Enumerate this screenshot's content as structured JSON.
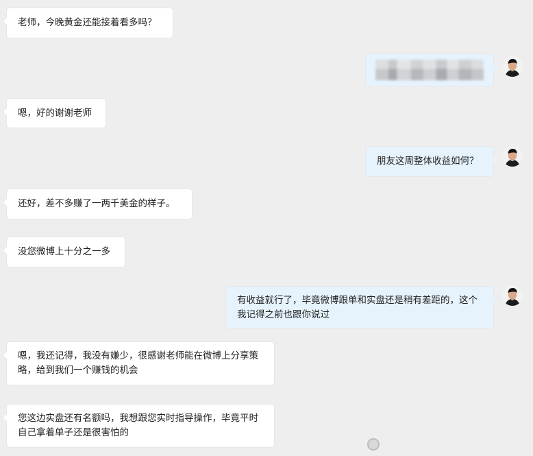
{
  "conversation": {
    "messages": [
      {
        "side": "left",
        "text": "老师，今晚黄金还能接着看多吗？"
      },
      {
        "side": "right",
        "text": "",
        "redacted": true
      },
      {
        "side": "left",
        "text": "嗯，好的谢谢老师"
      },
      {
        "side": "right",
        "text": "朋友这周整体收益如何？"
      },
      {
        "side": "left",
        "text": "还好，差不多赚了一两千美金的样子。"
      },
      {
        "side": "left",
        "text": "没您微博上十分之一多"
      },
      {
        "side": "right",
        "text": "有收益就行了，毕竟微博跟单和实盘还是稍有差距的，这个我记得之前也跟你说过"
      },
      {
        "side": "left",
        "text": "嗯，我还记得，我没有嫌少，很感谢老师能在微博上分享策略，给到我们一个赚钱的机会"
      },
      {
        "side": "left",
        "text": "您这边实盘还有名额吗，我想跟您实时指导操作，毕竟平时自己拿着单子还是很害怕的"
      }
    ]
  },
  "watermark": {
    "text": ""
  },
  "colors": {
    "background": "#eeeeee",
    "left_bubble": "#ffffff",
    "right_bubble": "#e6f3fd"
  },
  "icons": {
    "avatar": "user-avatar-icon"
  }
}
